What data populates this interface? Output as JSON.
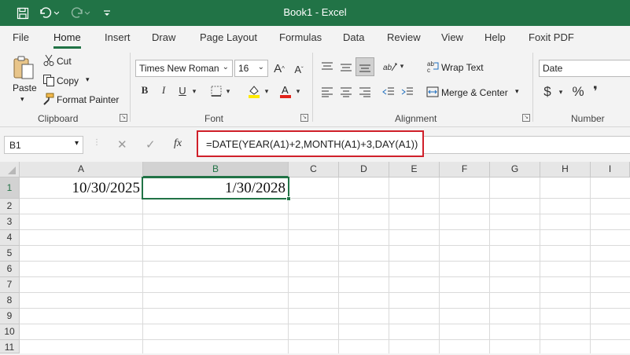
{
  "window": {
    "title": "Book1  -  Excel"
  },
  "menu_tabs": [
    {
      "label": "File"
    },
    {
      "label": "Home"
    },
    {
      "label": "Insert"
    },
    {
      "label": "Draw"
    },
    {
      "label": "Page Layout"
    },
    {
      "label": "Formulas"
    },
    {
      "label": "Data"
    },
    {
      "label": "Review"
    },
    {
      "label": "View"
    },
    {
      "label": "Help"
    },
    {
      "label": "Foxit PDF"
    }
  ],
  "active_tab": "Home",
  "clipboard": {
    "paste": "Paste",
    "cut": "Cut",
    "copy": "Copy",
    "format_painter": "Format Painter",
    "group": "Clipboard"
  },
  "font": {
    "name": "Times New Roman",
    "size": "16",
    "group": "Font"
  },
  "alignment": {
    "wrap_text": "Wrap Text",
    "merge_center": "Merge & Center",
    "group": "Alignment"
  },
  "number": {
    "format": "Date",
    "currency": "$",
    "percent": "%",
    "comma": "❜",
    "group": "Number"
  },
  "formula_bar": {
    "name_box": "B1",
    "fx": "fx",
    "formula": "=DATE(YEAR(A1)+2,MONTH(A1)+3,DAY(A1))"
  },
  "columns": [
    "A",
    "B",
    "C",
    "D",
    "E",
    "F",
    "G",
    "H",
    "I"
  ],
  "rows": [
    "1",
    "2",
    "3",
    "4",
    "5",
    "6",
    "7",
    "8",
    "9",
    "10",
    "11"
  ],
  "cells": {
    "A1": "10/30/2025",
    "B1": "1/30/2028"
  },
  "selected_cell": "B1",
  "colors": {
    "excel_green": "#217346",
    "highlight_red": "#d0202a"
  }
}
